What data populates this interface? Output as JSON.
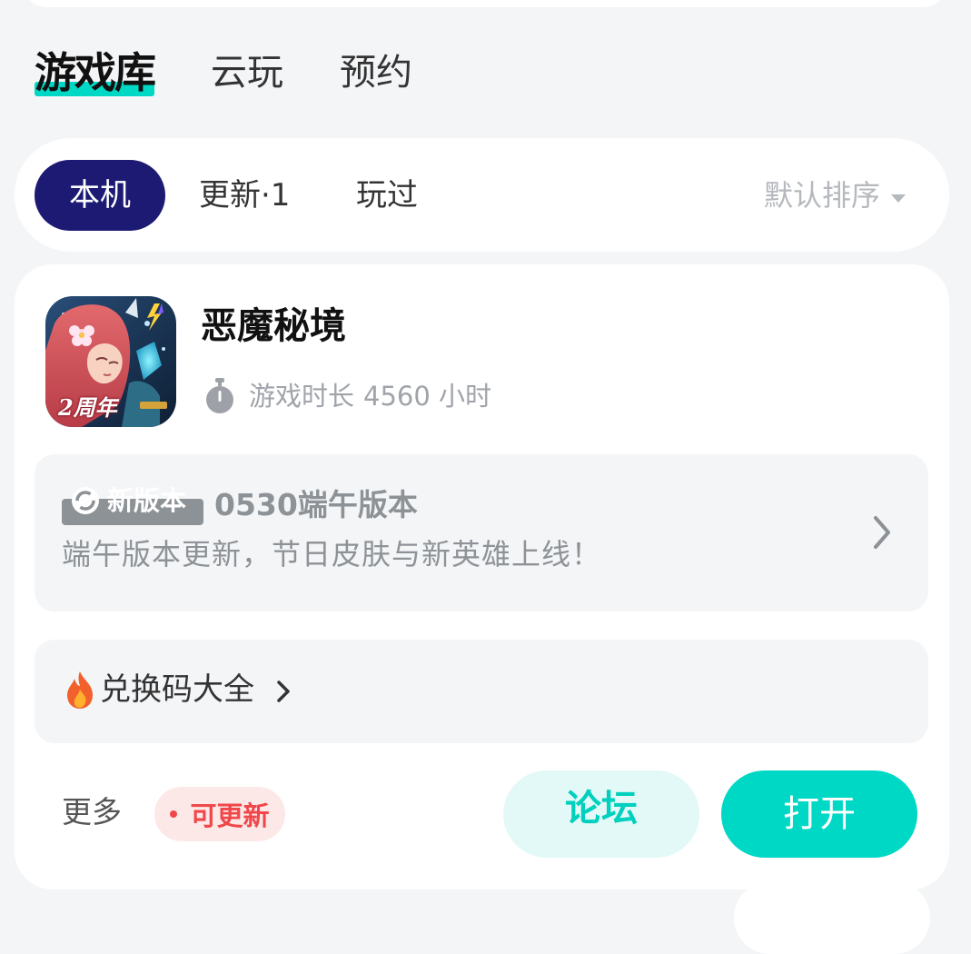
{
  "colors": {
    "accent": "#00d8c6",
    "active_chip": "#1d1a74",
    "update_red": "#f0474a",
    "page_bg": "#f4f5f7"
  },
  "main_tabs": [
    {
      "label": "游戏库",
      "active": true
    },
    {
      "label": "云玩",
      "active": false
    },
    {
      "label": "预约",
      "active": false
    }
  ],
  "filter": {
    "chips": [
      {
        "label": "本机",
        "active": true
      },
      {
        "label": "更新·1",
        "active": false
      },
      {
        "label": "玩过",
        "active": false
      }
    ],
    "sort_label": "默认排序",
    "sort_icon": "caret-down-icon"
  },
  "game": {
    "title": "恶魔秘境",
    "icon_badge": "2周年",
    "playtime_icon": "stopwatch-icon",
    "playtime_label": "游戏时长",
    "playtime_value": "4560 小时",
    "news": {
      "badge": "新版本",
      "title": "0530端午版本",
      "desc": "端午版本更新，节日皮肤与新英雄上线！"
    },
    "redeem": {
      "icon": "fire-icon",
      "label": "兑换码大全"
    },
    "more_label": "更多",
    "update_badge": "可更新",
    "forum_button": "论坛",
    "open_button": "打开"
  }
}
